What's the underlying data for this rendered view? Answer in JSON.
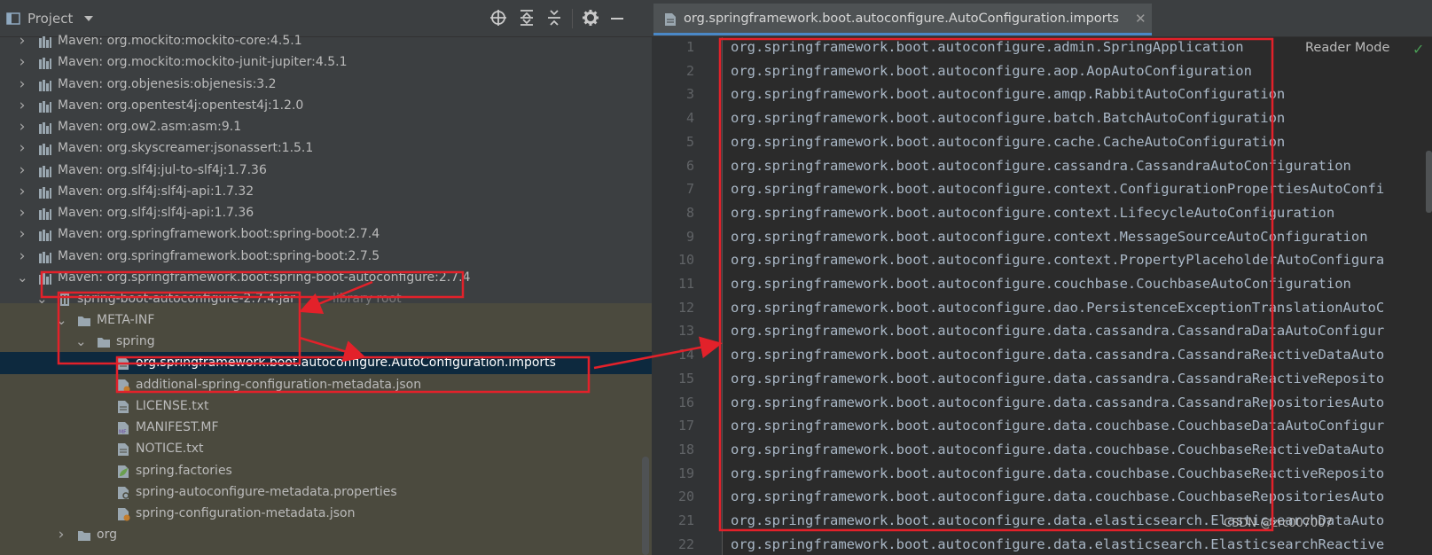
{
  "project_panel": {
    "title": "Project",
    "icons": [
      "select-opened-file-icon",
      "expand-all-icon",
      "collapse-all-icon",
      "gear-icon",
      "minimize-icon"
    ]
  },
  "tree": [
    {
      "label": "Maven: org.mockito:mockito-core:4.5.1",
      "type": "maven-library",
      "expanded": false
    },
    {
      "label": "Maven: org.mockito:mockito-junit-jupiter:4.5.1",
      "type": "maven-library",
      "expanded": false
    },
    {
      "label": "Maven: org.objenesis:objenesis:3.2",
      "type": "maven-library",
      "expanded": false
    },
    {
      "label": "Maven: org.opentest4j:opentest4j:1.2.0",
      "type": "maven-library",
      "expanded": false
    },
    {
      "label": "Maven: org.ow2.asm:asm:9.1",
      "type": "maven-library",
      "expanded": false
    },
    {
      "label": "Maven: org.skyscreamer:jsonassert:1.5.1",
      "type": "maven-library",
      "expanded": false
    },
    {
      "label": "Maven: org.slf4j:jul-to-slf4j:1.7.36",
      "type": "maven-library",
      "expanded": false
    },
    {
      "label": "Maven: org.slf4j:slf4j-api:1.7.32",
      "type": "maven-library",
      "expanded": false
    },
    {
      "label": "Maven: org.slf4j:slf4j-api:1.7.36",
      "type": "maven-library",
      "expanded": false
    },
    {
      "label": "Maven: org.springframework.boot:spring-boot:2.7.4",
      "type": "maven-library",
      "expanded": false
    },
    {
      "label": "Maven: org.springframework.boot:spring-boot:2.7.5",
      "type": "maven-library",
      "expanded": false
    },
    {
      "label": "Maven: org.springframework.boot:spring-boot-autoconfigure:2.7.4",
      "type": "maven-library",
      "expanded": true
    },
    {
      "label": "spring-boot-autoconfigure-2.7.4.jar",
      "suffix": "library root",
      "type": "jar",
      "expanded": true
    },
    {
      "label": "META-INF",
      "type": "folder",
      "expanded": true
    },
    {
      "label": "spring",
      "type": "folder",
      "expanded": true
    },
    {
      "label": "org.springframework.boot.autoconfigure.AutoConfiguration.imports",
      "type": "text-file",
      "selected": true
    },
    {
      "label": "additional-spring-configuration-metadata.json",
      "type": "json-file"
    },
    {
      "label": "LICENSE.txt",
      "type": "text-file"
    },
    {
      "label": "MANIFEST.MF",
      "type": "manifest-file"
    },
    {
      "label": "NOTICE.txt",
      "type": "text-file"
    },
    {
      "label": "spring.factories",
      "type": "spring-file"
    },
    {
      "label": "spring-autoconfigure-metadata.properties",
      "type": "properties-file"
    },
    {
      "label": "spring-configuration-metadata.json",
      "type": "json-file"
    },
    {
      "label": "org",
      "type": "folder",
      "expanded": false
    }
  ],
  "editor": {
    "tab_label": "org.springframework.boot.autoconfigure.AutoConfiguration.imports",
    "reader_mode": "Reader Mode",
    "lines": [
      "org.springframework.boot.autoconfigure.admin.SpringApplication",
      "org.springframework.boot.autoconfigure.aop.AopAutoConfiguration",
      "org.springframework.boot.autoconfigure.amqp.RabbitAutoConfiguration",
      "org.springframework.boot.autoconfigure.batch.BatchAutoConfiguration",
      "org.springframework.boot.autoconfigure.cache.CacheAutoConfiguration",
      "org.springframework.boot.autoconfigure.cassandra.CassandraAutoConfiguration",
      "org.springframework.boot.autoconfigure.context.ConfigurationPropertiesAutoConfi",
      "org.springframework.boot.autoconfigure.context.LifecycleAutoConfiguration",
      "org.springframework.boot.autoconfigure.context.MessageSourceAutoConfiguration",
      "org.springframework.boot.autoconfigure.context.PropertyPlaceholderAutoConfigura",
      "org.springframework.boot.autoconfigure.couchbase.CouchbaseAutoConfiguration",
      "org.springframework.boot.autoconfigure.dao.PersistenceExceptionTranslationAutoC",
      "org.springframework.boot.autoconfigure.data.cassandra.CassandraDataAutoConfigur",
      "org.springframework.boot.autoconfigure.data.cassandra.CassandraReactiveDataAuto",
      "org.springframework.boot.autoconfigure.data.cassandra.CassandraReactiveReposito",
      "org.springframework.boot.autoconfigure.data.cassandra.CassandraRepositoriesAuto",
      "org.springframework.boot.autoconfigure.data.couchbase.CouchbaseDataAutoConfigur",
      "org.springframework.boot.autoconfigure.data.couchbase.CouchbaseReactiveDataAuto",
      "org.springframework.boot.autoconfigure.data.couchbase.CouchbaseReactiveReposito",
      "org.springframework.boot.autoconfigure.data.couchbase.CouchbaseRepositoriesAuto",
      "org.springframework.boot.autoconfigure.data.elasticsearch.ElasticsearchDataAuto",
      "org.springframework.boot.autoconfigure.data.elasticsearch.ElasticsearchReactive"
    ]
  },
  "watermark": "CSDN @zrc007007",
  "colors": {
    "annotation": "#e3212a",
    "selection": "#0d293e",
    "panel": "#3c3f41",
    "editor": "#2b2b2b",
    "tab_underline": "#4a88c7"
  }
}
